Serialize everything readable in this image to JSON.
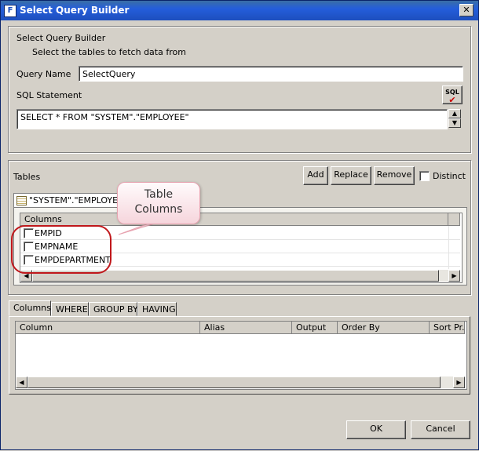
{
  "window": {
    "title": "Select Query Builder",
    "close_glyph": "✕",
    "app_icon_glyph": "F"
  },
  "header": {
    "title": "Select Query Builder",
    "subtitle": "Select the tables to fetch data from"
  },
  "query": {
    "name_label": "Query Name",
    "name_value": "SelectQuery",
    "sql_label": "SQL Statement",
    "sql_value": "SELECT * FROM \"SYSTEM\".\"EMPLOYEE\"",
    "sql_button_label": "SQL"
  },
  "tables": {
    "label": "Tables",
    "add_label": "Add",
    "replace_label": "Replace",
    "remove_label": "Remove",
    "distinct_label": "Distinct",
    "tab_label": "\"SYSTEM\".\"EMPLOYEE\"",
    "columns_header": "Columns",
    "columns": [
      "EMPID",
      "EMPNAME",
      "EMPDEPARTMENT"
    ]
  },
  "callout": {
    "line1": "Table",
    "line2": "Columns"
  },
  "bottom_tabs": [
    "Columns",
    "WHERE",
    "GROUP BY",
    "HAVING"
  ],
  "grid_headers": [
    "Column",
    "Alias",
    "Output",
    "Order By",
    "Sort Pr..."
  ],
  "footer": {
    "ok_label": "OK",
    "cancel_label": "Cancel"
  },
  "colors": {
    "titlebar": "#245edb",
    "callout_border": "#e7a3b0",
    "annotation": "#c0171b"
  }
}
